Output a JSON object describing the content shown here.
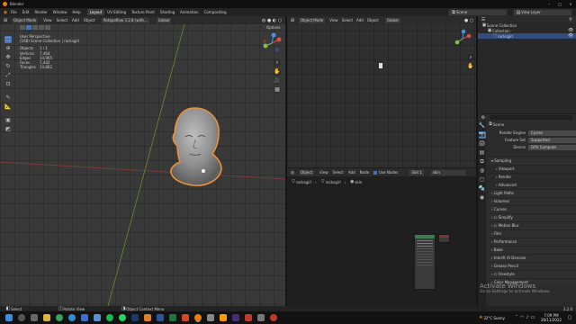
{
  "window": {
    "title": "Blender"
  },
  "topbar": {
    "menus": [
      "File",
      "Edit",
      "Render",
      "Window",
      "Help"
    ],
    "workspaces": [
      "Layout",
      "UV Editing",
      "Texture Paint",
      "Shading",
      "Animation",
      "Compositing"
    ],
    "active_workspace": "Layout",
    "scene_label": "Scene",
    "view_layer_label": "View Layer"
  },
  "viewport": {
    "mode": "Object Mode",
    "menus": [
      "View",
      "Select",
      "Add",
      "Object"
    ],
    "transform_pivot": "Retopoflow 3.2.8 (with...",
    "orientation": "Global",
    "options_label": "Options",
    "info": {
      "title": "User Perspective",
      "subtitle": "(168) Scene Collection | rocksgirl",
      "stats": [
        {
          "label": "Objects",
          "value": "1 / 1"
        },
        {
          "label": "Vertices",
          "value": "7,464"
        },
        {
          "label": "Edges",
          "value": "14,905"
        },
        {
          "label": "Faces",
          "value": "7,442"
        },
        {
          "label": "Triangles",
          "value": "14,882"
        }
      ]
    }
  },
  "viewport2": {
    "mode": "Object Mode",
    "menus": [
      "View",
      "Select",
      "Add",
      "Object"
    ],
    "orientation": "Global"
  },
  "node_editor": {
    "editor_type": "Object",
    "menus": [
      "View",
      "Select",
      "Add",
      "Node"
    ],
    "use_nodes_label": "Use Nodes",
    "slot": "Slot 1",
    "material": "skin",
    "breadcrumb": [
      "rocksgirl",
      "rocksgirl",
      "skin"
    ]
  },
  "outliner": {
    "items": [
      {
        "label": "Scene Collection",
        "indent": 0
      },
      {
        "label": "Collection",
        "indent": 1
      },
      {
        "label": "rocksgirl",
        "indent": 2
      }
    ]
  },
  "properties": {
    "scene_name": "Scene",
    "render_engine": {
      "label": "Render Engine",
      "value": "Cycles"
    },
    "feature_set": {
      "label": "Feature Set",
      "value": "Supported"
    },
    "device": {
      "label": "Device",
      "value": "GPU Compute"
    },
    "sections": [
      "Sampling",
      "Viewport",
      "Render",
      "Advanced",
      "Light Paths",
      "Volumes",
      "Curves",
      "Simplify",
      "Motion Blur",
      "Film",
      "Performance",
      "Bake",
      "Intel® AI Denoise",
      "Grease Pencil",
      "Freestyle",
      "Color Management"
    ]
  },
  "statusbar": {
    "select": "Select",
    "rotate": "Rotate View",
    "context": "Object Context Menu",
    "version": "3.2.0"
  },
  "watermark": {
    "title": "Activate Windows",
    "subtitle": "Go to Settings to activate Windows."
  },
  "taskbar": {
    "weather": "32°C  Sunny",
    "time": "7:09 PM",
    "date": "26/11/2022"
  },
  "colors": {
    "accent": "#4772b3",
    "outline": "#e8913a",
    "viewport_bg": "#393939"
  }
}
